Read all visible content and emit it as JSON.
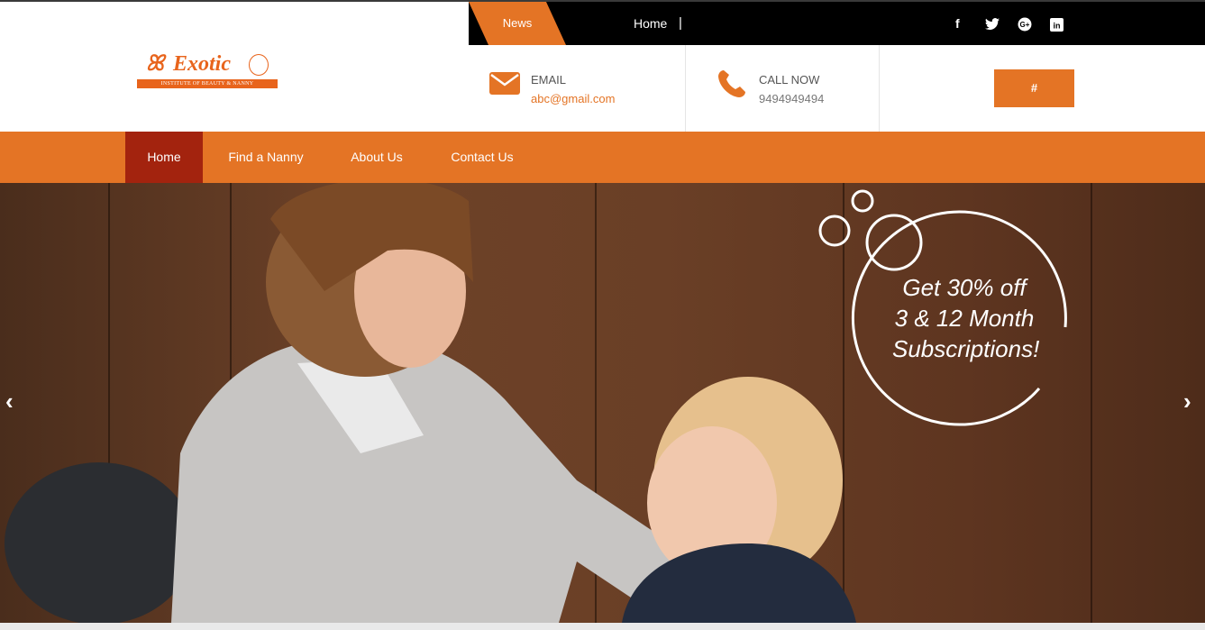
{
  "topbar": {
    "news_label": "News",
    "home_link": "Home",
    "separator": "|",
    "social": [
      {
        "icon": "facebook-icon",
        "glyph": "f"
      },
      {
        "icon": "twitter-icon",
        "glyph": "t"
      },
      {
        "icon": "google-plus-icon",
        "glyph": "G+"
      },
      {
        "icon": "linkedin-icon",
        "glyph": "in"
      }
    ]
  },
  "header": {
    "logo_text": "Exotic",
    "logo_tagline": "INSTITUTE OF BEAUTY & NANNY",
    "email_label": "EMAIL",
    "email_value": "abc@gmail.com",
    "phone_label": "CALL NOW",
    "phone_value": "9494949494",
    "cta_label": "#"
  },
  "nav": {
    "items": [
      {
        "label": "Home",
        "active": true
      },
      {
        "label": "Find a Nanny",
        "active": false
      },
      {
        "label": "About Us",
        "active": false
      },
      {
        "label": "Contact Us",
        "active": false
      }
    ]
  },
  "hero": {
    "promo_line1": "Get 30% off",
    "promo_line2": "3 & 12 Month",
    "promo_line3": "Subscriptions!",
    "prev_arrow": "‹",
    "next_arrow": "›"
  },
  "colors": {
    "accent": "#e47425",
    "nav_active": "#a3230e",
    "topbar": "#000000"
  }
}
